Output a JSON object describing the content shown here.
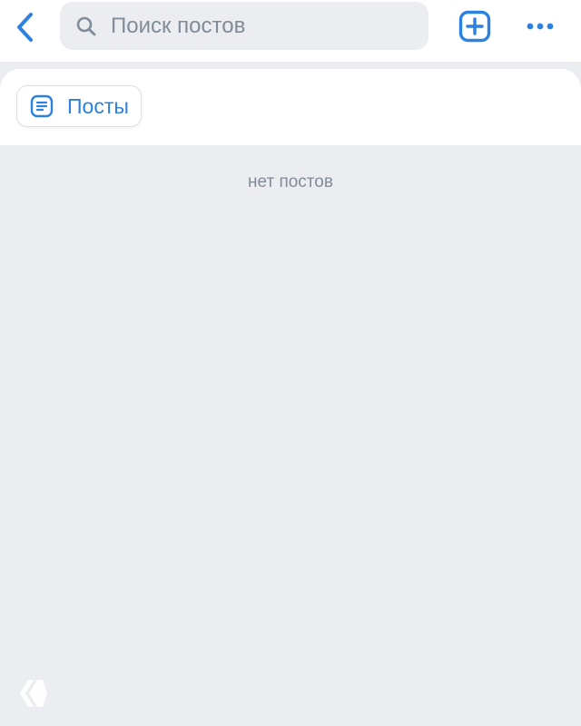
{
  "header": {
    "back_icon": "chevron-left-icon",
    "search": {
      "icon": "search-icon",
      "placeholder": "Поиск постов",
      "value": ""
    },
    "add_icon": "add-square-icon",
    "more_icon": "more-horizontal-icon"
  },
  "tabs": [
    {
      "label": "Посты",
      "icon": "article-icon",
      "selected": true
    }
  ],
  "content": {
    "empty_message": "нет постов"
  },
  "colors": {
    "accent": "#2d81e0",
    "background": "#ebedf0",
    "surface": "#ffffff",
    "secondary_text": "#818c99"
  }
}
